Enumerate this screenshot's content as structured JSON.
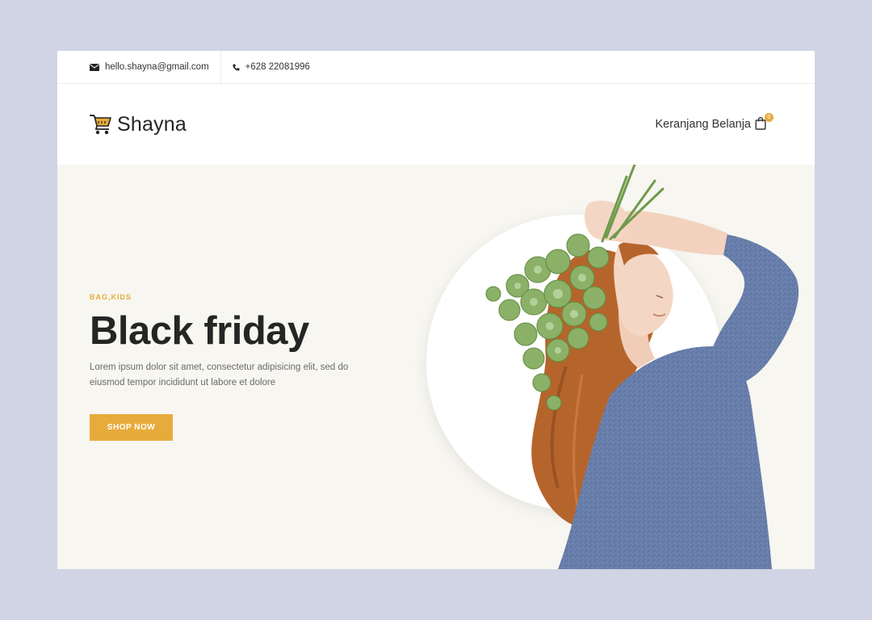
{
  "topbar": {
    "email": "hello.shayna@gmail.com",
    "phone": "+628 22081996",
    "email_icon": "envelope-icon",
    "phone_icon": "phone-icon"
  },
  "header": {
    "brand": "Shayna",
    "logo_icon": "shopping-cart-icon",
    "cart_label": "Keranjang Belanja",
    "cart_icon": "shopping-bag-icon",
    "cart_count": "0"
  },
  "hero": {
    "tag": "BAG,KIDS",
    "title": "Black friday",
    "description": "Lorem ipsum dolor sit amet, consectetur adipisicing elit, sed do eiusmod tempor incididunt ut labore et dolore",
    "button_label": "SHOP NOW",
    "image": "woman-holding-flowers-image"
  },
  "colors": {
    "accent": "#e7ab3c",
    "hero_background": "#f7f6f1",
    "outer_background": "#d0d4e4",
    "sweater": "#6a80ad",
    "hair": "#b5652c"
  }
}
